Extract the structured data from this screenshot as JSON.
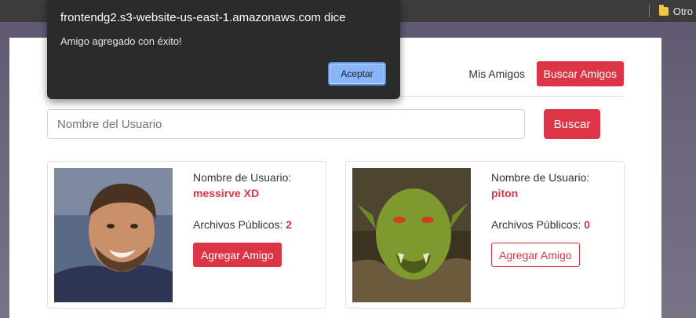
{
  "browser": {
    "bookmark_label": "Otro"
  },
  "nav": {
    "my_friends": "Mis Amigos",
    "find_friends": "Buscar Amigos"
  },
  "search": {
    "placeholder": "Nombre del Usuario",
    "button": "Buscar"
  },
  "cards": [
    {
      "username_label": "Nombre de Usuario:",
      "username": "messirve XD",
      "files_label": "Archivos Públicos:",
      "files_count": "2",
      "add_button": "Agregar Amigo"
    },
    {
      "username_label": "Nombre de Usuario:",
      "username": "piton",
      "files_label": "Archivos Públicos:",
      "files_count": "0",
      "add_button": "Agregar Amigo"
    }
  ],
  "dialog": {
    "title": "frontendg2.s3-website-us-east-1.amazonaws.com dice",
    "message": "Amigo agregado con éxito!",
    "button": "Aceptar"
  },
  "colors": {
    "accent": "#dc3545",
    "dialog_bg": "#2b2b2b",
    "dialog_button": "#8ab4f8"
  }
}
